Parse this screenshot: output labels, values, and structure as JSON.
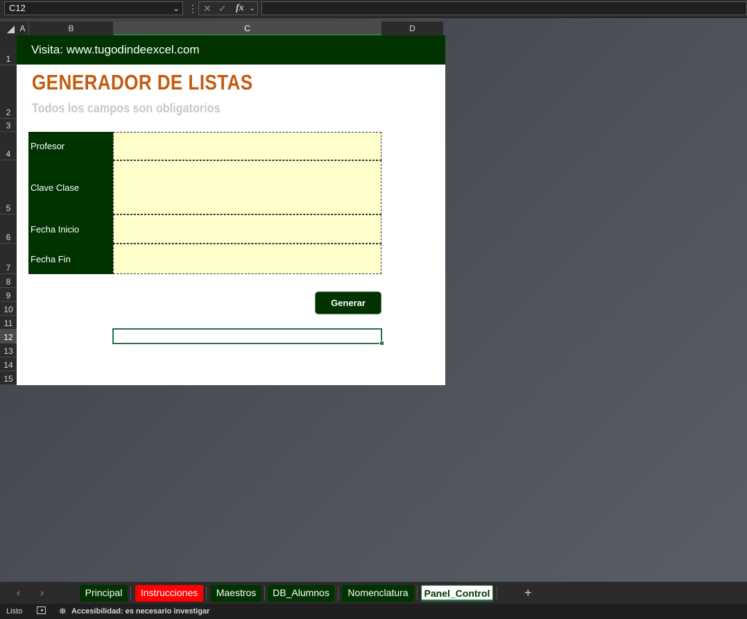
{
  "formula_bar": {
    "cell_ref": "C12",
    "cancel_icon": "✕",
    "enter_icon": "✓",
    "fx_label": "fx",
    "formula": ""
  },
  "columns": [
    "A",
    "B",
    "C",
    "D"
  ],
  "rows": [
    "1",
    "2",
    "3",
    "4",
    "5",
    "6",
    "7",
    "8",
    "9",
    "10",
    "11",
    "12",
    "13",
    "14",
    "15"
  ],
  "sheet": {
    "banner": "Visita: www.tugodindeexcel.com",
    "title": "GENERADOR DE LISTAS",
    "subtitle": "Todos los campos son obligatorios",
    "fields": [
      {
        "label": "Profesor",
        "value": ""
      },
      {
        "label": "Clave Clase",
        "value": ""
      },
      {
        "label": "Fecha Inicio",
        "value": ""
      },
      {
        "label": "Fecha Fin",
        "value": ""
      }
    ],
    "generate_label": "Generar"
  },
  "tabs": [
    {
      "label": "Principal",
      "color": "#003300"
    },
    {
      "label": "Instrucciones",
      "color": "#ff0000"
    },
    {
      "label": "Maestros",
      "color": "#003300"
    },
    {
      "label": "DB_Alumnos",
      "color": "#003300"
    },
    {
      "label": "Nomenclatura",
      "color": "#003300"
    },
    {
      "label": "Panel_Control",
      "color": "#ffffff",
      "active": true
    }
  ],
  "add_sheet": "+",
  "status": {
    "ready": "Listo",
    "accessibility": "Accesibilidad: es necesario investigar"
  },
  "colors": {
    "banner": "#003300",
    "title": "#c55a11",
    "input_fill": "#ffffcc",
    "selection": "#217346"
  }
}
